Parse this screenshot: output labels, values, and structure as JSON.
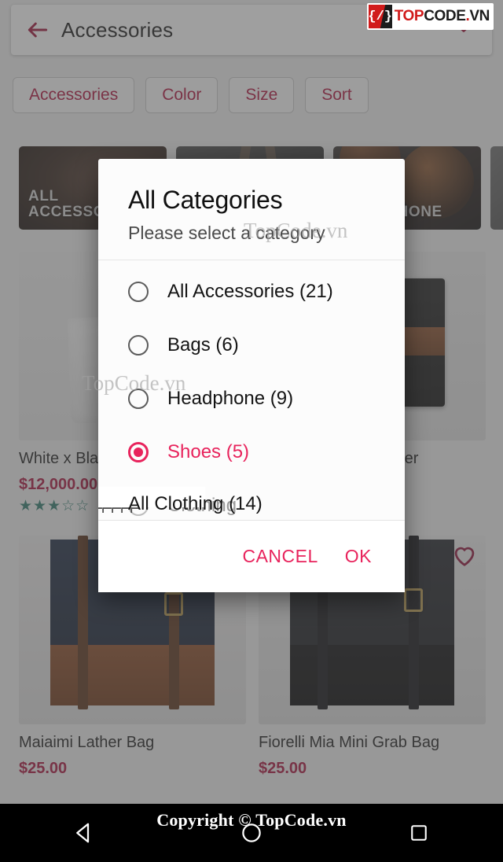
{
  "appbar": {
    "title": "Accessories",
    "back_icon": "arrow-left-icon",
    "close_icon": "close-x-icon"
  },
  "filters": {
    "chips": [
      {
        "label": "Accessories"
      },
      {
        "label": "Color"
      },
      {
        "label": "Size"
      },
      {
        "label": "Sort"
      }
    ]
  },
  "banners": [
    {
      "label": "ALL\nACCESSORIES"
    },
    {
      "label": ""
    },
    {
      "label": "HEADPHONE"
    },
    {
      "label": ""
    }
  ],
  "products": [
    {
      "title": "White x Black Leather Bag",
      "price": "$12,000.00",
      "rating": "★★★☆☆",
      "favorite": false
    },
    {
      "title": "Black & Brown Leather",
      "price": "",
      "rating": "",
      "favorite": false
    },
    {
      "title": "Maiaimi Lather Bag",
      "price": "$25.00",
      "rating": "",
      "favorite": false
    },
    {
      "title": "Fiorelli Mia Mini Grab Bag",
      "price": "$25.00",
      "rating": "",
      "favorite": true
    }
  ],
  "dialog": {
    "title": "All Categories",
    "subtitle": "Please select a category",
    "options": [
      {
        "label": "All Accessories (21)",
        "selected": false,
        "disabled": false
      },
      {
        "label": "Bags (6)",
        "selected": false,
        "disabled": false
      },
      {
        "label": "Headphone (9)",
        "selected": false,
        "disabled": false
      },
      {
        "label": "Shoes (5)",
        "selected": true,
        "disabled": false
      },
      {
        "label": "Clothing",
        "selected": false,
        "disabled": true
      }
    ],
    "partial_option": {
      "label": "All Clothing (14)"
    },
    "cancel_label": "CANCEL",
    "ok_label": "OK"
  },
  "watermarks": {
    "text_1": "TopCode.vn",
    "text_2": "TopCode.vn",
    "logo_mark": "{/}",
    "logo_top": "TOP",
    "logo_code": "CODE",
    "logo_dot": ".",
    "logo_vn": "VN"
  },
  "navbar": {
    "copyright": "Copyright © TopCode.vn",
    "back_icon": "triangle-back-icon",
    "home_icon": "circle-home-icon",
    "recents_icon": "square-recents-icon"
  },
  "colors": {
    "accent_pink": "#e8235c",
    "brand_crimson": "#a8123c",
    "star_teal": "#2f7a6e",
    "scrim": "rgba(80,80,80,0.55)"
  }
}
